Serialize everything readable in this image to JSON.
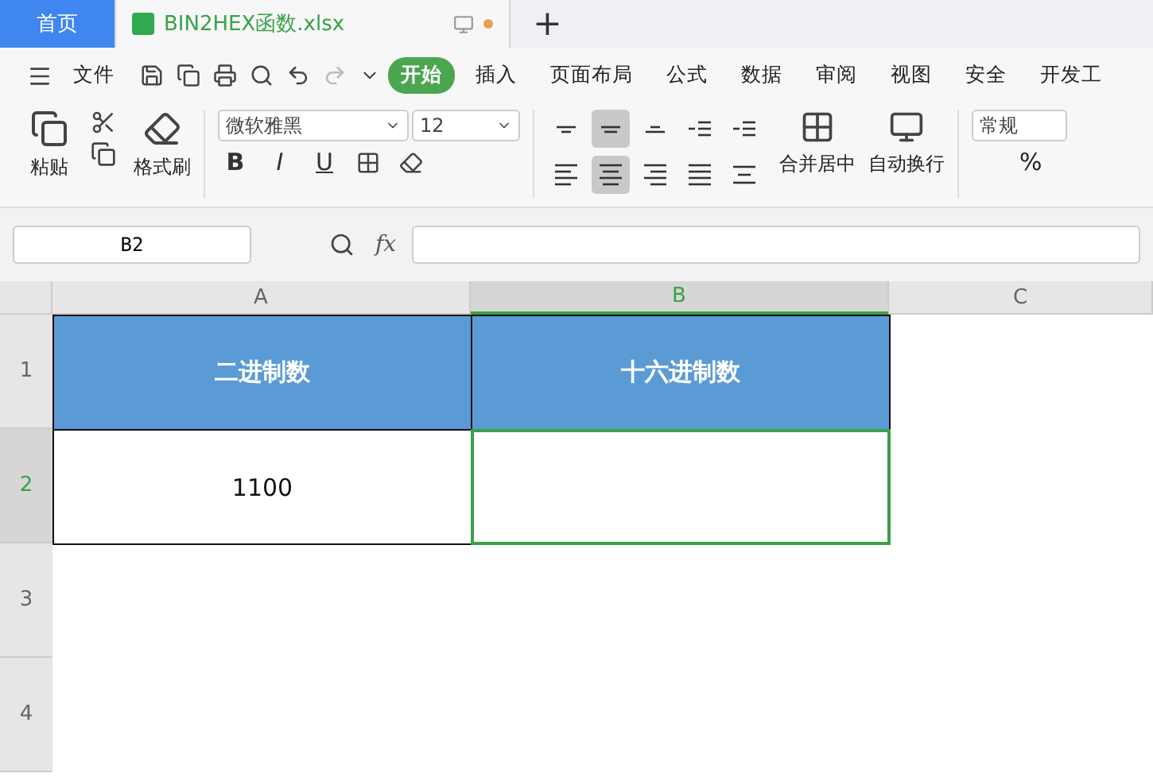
{
  "tabs": [
    {
      "label": "首页",
      "kind": "home",
      "selected": false
    },
    {
      "label": "BIN2HEX函数.xlsx",
      "kind": "file",
      "selected": true,
      "unsaved": true
    }
  ],
  "new_tab": "+",
  "menu": {
    "file_label": "文件",
    "items": [
      {
        "label": "开始",
        "selected": true
      },
      {
        "label": "插入",
        "selected": false
      },
      {
        "label": "页面布局",
        "selected": false
      },
      {
        "label": "公式",
        "selected": false
      },
      {
        "label": "数据",
        "selected": false
      },
      {
        "label": "审阅",
        "selected": false
      },
      {
        "label": "视图",
        "selected": false
      },
      {
        "label": "安全",
        "selected": false
      },
      {
        "label": "开发工",
        "selected": false
      }
    ]
  },
  "ribbon": {
    "paste": "粘贴",
    "format_painter": "格式刷",
    "font": "微软雅黑",
    "size": "12",
    "bold": "B",
    "italic": "I",
    "underline": "U",
    "align": [
      {
        "kind": "top",
        "selected": false
      },
      {
        "kind": "middle",
        "selected": true
      },
      {
        "kind": "bottom",
        "selected": false
      },
      {
        "kind": "outdent",
        "selected": false
      },
      {
        "kind": "indent",
        "selected": false
      },
      {
        "kind": "left",
        "selected": false
      },
      {
        "kind": "center",
        "selected": true
      },
      {
        "kind": "right",
        "selected": false
      },
      {
        "kind": "justify",
        "selected": false
      },
      {
        "kind": "distribute",
        "selected": false
      }
    ],
    "merge": "合并居中",
    "wrap": "自动换行",
    "number_format": "常规",
    "percent": "%"
  },
  "formula_bar": {
    "name_box": "B2",
    "fx": "fx"
  },
  "columns": [
    {
      "label": "A",
      "selected": false
    },
    {
      "label": "B",
      "selected": true
    },
    {
      "label": "C",
      "selected": false
    }
  ],
  "rows": [
    {
      "label": "1",
      "selected": false,
      "cells": [
        {
          "text": "二进制数",
          "kind": "header",
          "active": false
        },
        {
          "text": "十六进制数",
          "kind": "header",
          "active": false
        }
      ]
    },
    {
      "label": "2",
      "selected": true,
      "cells": [
        {
          "text": "1100",
          "kind": "data",
          "active": false
        },
        {
          "kind": "data",
          "active": true
        }
      ]
    },
    {
      "label": "3",
      "selected": false,
      "cells": []
    },
    {
      "label": "4",
      "selected": false,
      "cells": []
    }
  ]
}
